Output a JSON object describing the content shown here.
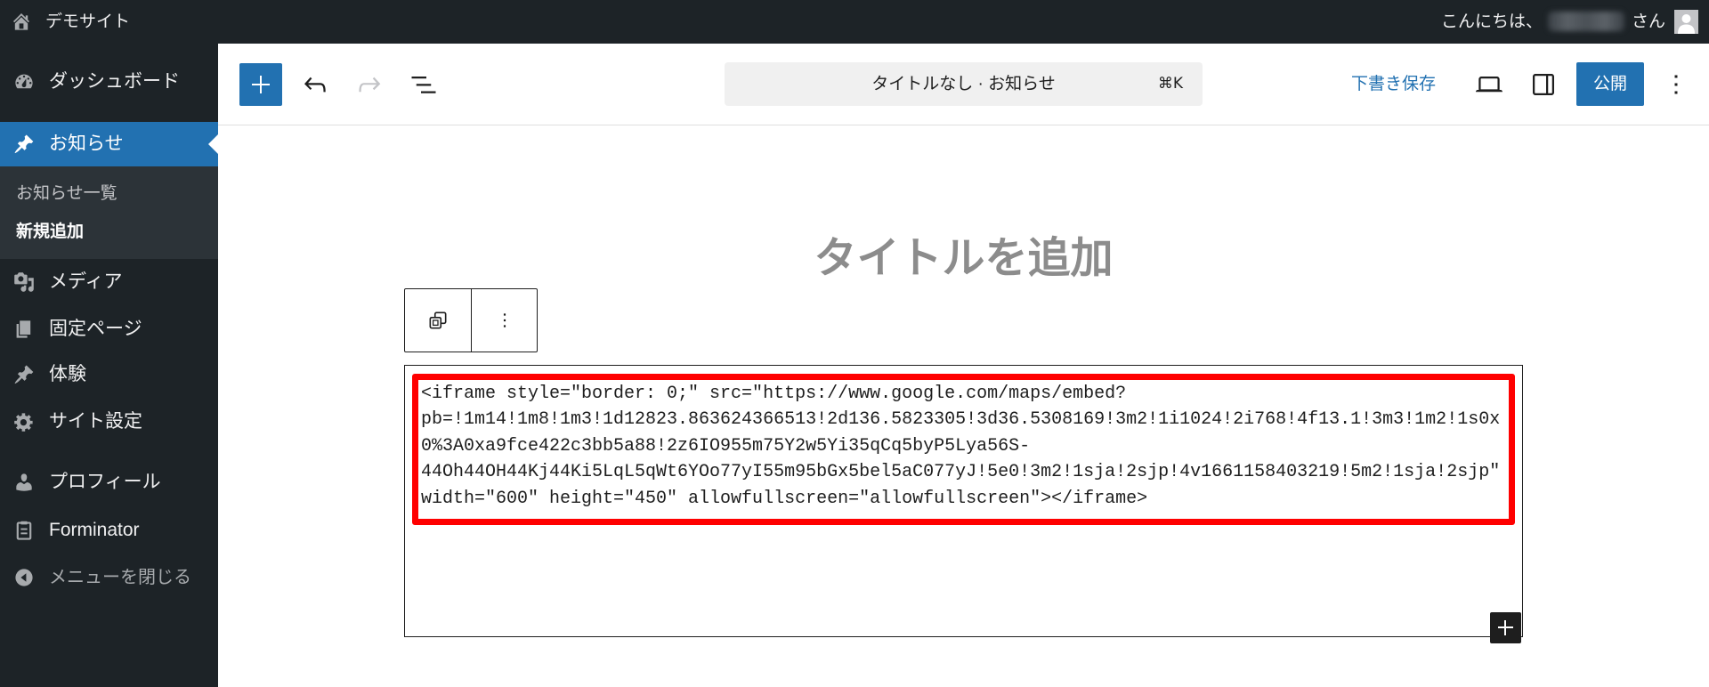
{
  "colors": {
    "admin_bar_bg": "#1d2327",
    "submenu_bg": "#2c3338",
    "accent": "#2271b1",
    "highlight_border": "#ff0000"
  },
  "admin_bar": {
    "home_icon": "home-icon",
    "site_name": "デモサイト",
    "greeting": "こんにちは、",
    "honorific": "さん",
    "avatar_icon": "avatar"
  },
  "sidebar": {
    "items": [
      {
        "label": "ダッシュボード",
        "icon": "dashboard-icon"
      },
      {
        "label": "お知らせ",
        "icon": "pin-icon",
        "active": true
      },
      {
        "label": "メディア",
        "icon": "media-icon"
      },
      {
        "label": "固定ページ",
        "icon": "pages-icon"
      },
      {
        "label": "体験",
        "icon": "pin-icon"
      },
      {
        "label": "サイト設定",
        "icon": "gear-icon"
      },
      {
        "label": "プロフィール",
        "icon": "user-icon"
      },
      {
        "label": "Forminator",
        "icon": "clipboard-icon"
      }
    ],
    "submenu": [
      {
        "label": "お知らせ一覧"
      },
      {
        "label": "新規追加",
        "current": true
      }
    ],
    "collapse": {
      "label": "メニューを閉じる",
      "icon": "collapse-icon"
    }
  },
  "editor_header": {
    "document_title": "タイトルなし · お知らせ",
    "shortcut": "⌘K",
    "save_draft": "下書き保存",
    "publish": "公開"
  },
  "canvas": {
    "title_placeholder": "タイトルを追加",
    "code_lines": [
      "<iframe style=\"border: 0;\" src=\"https://www.google.com/maps/embed?",
      "pb=!1m14!1m8!1m3!1d12823.863624366513!2d136.5823305!3d36.5308169!3m2!1i1024!2i768!4f13.1!3m3!1m2!1s0x",
      "0%3A0xa9fce422c3bb5a88!2z6IO955m75Y2w5Yi35qCq5byP5Lya56S-",
      "44Oh44OH44Kj44Ki5LqL5qWt6YOo77yI55m95bGx5bel5aC077yJ!5e0!3m2!1sja!2sjp!4v1661158403219!5m2!1sja!2sjp\"",
      "width=\"600\" height=\"450\" allowfullscreen=\"allowfullscreen\"></iframe>"
    ]
  }
}
